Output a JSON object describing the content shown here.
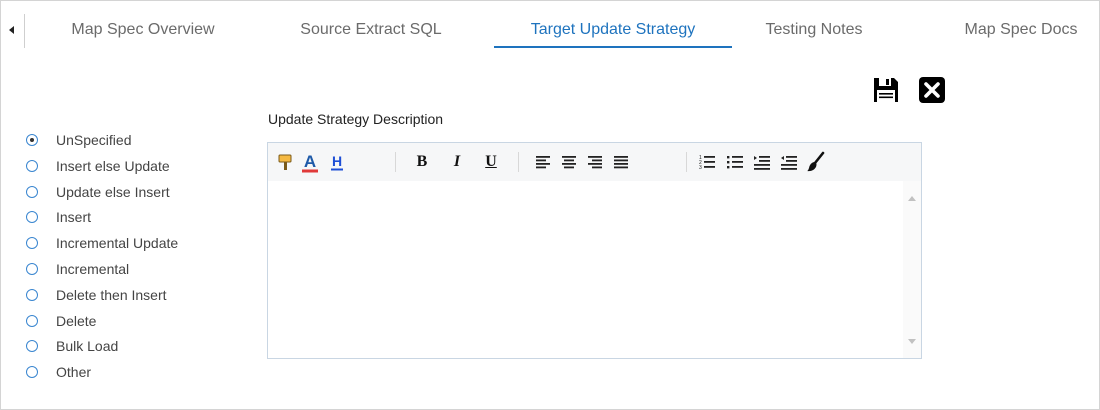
{
  "tabs": [
    {
      "label": "Map Spec Overview",
      "active": false
    },
    {
      "label": "Source Extract SQL",
      "active": false
    },
    {
      "label": "Target Update Strategy",
      "active": true
    },
    {
      "label": "Testing Notes",
      "active": false
    },
    {
      "label": "Map Spec Docs",
      "active": false
    }
  ],
  "actions": {
    "save_icon": "floppy-disk-icon",
    "close_icon": "close-x-icon"
  },
  "update_strategy": {
    "selected": "UnSpecified",
    "options": [
      "UnSpecified",
      "Insert else Update",
      "Update else Insert",
      "Insert",
      "Incremental Update",
      "Incremental",
      "Delete then Insert",
      "Delete",
      "Bulk Load",
      "Other"
    ]
  },
  "editor": {
    "label": "Update Strategy Description",
    "content": "",
    "toolbar": {
      "bold": "B",
      "italic": "I",
      "underline": "U",
      "font_color": "A",
      "highlight": "H"
    }
  },
  "colors": {
    "accent": "#1e73be",
    "radio_border": "#3a86d0",
    "font_color_bar": "#e03a3a",
    "highlight_letter": "#1e4fd6"
  }
}
